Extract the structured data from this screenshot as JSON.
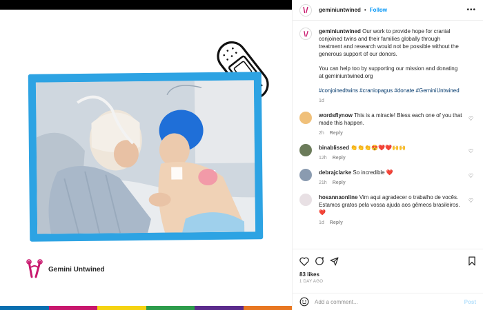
{
  "colors": {
    "accent": "#0095f6",
    "frame": "#2da3e3",
    "brand": "#c8176d",
    "rainbow": [
      "#0a6fb0",
      "#c8176d",
      "#f5d312",
      "#2d9c4b",
      "#5b2b8c",
      "#e87722"
    ]
  },
  "post_image": {
    "brand_name": "Gemini Untwined"
  },
  "header": {
    "username": "geminiuntwined",
    "separator": "•",
    "follow_label": "Follow",
    "more_icon": "more-icon"
  },
  "caption": {
    "username": "geminiuntwined",
    "text": "Our work to provide hope for cranial conjoined twins and their families globally through treatment and research would not be possible without the generous support of our donors.",
    "text2": "You can help too by supporting our mission and donating at geminiuntwined.org",
    "hashtags": "#conjoinedtwins #craniopagus #donate #GeminiUntwined",
    "time": "1d"
  },
  "comments": [
    {
      "username": "wordsflynow",
      "text": "This is a miracle! Bless each one of you that made this happen.",
      "time": "2h",
      "reply": "Reply",
      "avatar_color": "#f0c07a"
    },
    {
      "username": "binablissed",
      "text": "👏👏👏😍❤️❤️🙌🙌",
      "time": "12h",
      "reply": "Reply",
      "avatar_color": "#6b7b5a"
    },
    {
      "username": "debrajclarke",
      "text": "So incredible ❤️",
      "time": "21h",
      "reply": "Reply",
      "avatar_color": "#8a9bb0"
    },
    {
      "username": "hosannaonline",
      "text": "Vim aqui agradecer o trabalho de vocês. Estamos gratos pela vossa ajuda aos gêmeos brasileiros. ❤️",
      "time": "1d",
      "reply": "Reply",
      "avatar_color": "#e8e0e4"
    }
  ],
  "actions": {
    "likes": "83 likes",
    "time": "1 DAY AGO"
  },
  "add_comment": {
    "placeholder": "Add a comment...",
    "post_label": "Post"
  }
}
